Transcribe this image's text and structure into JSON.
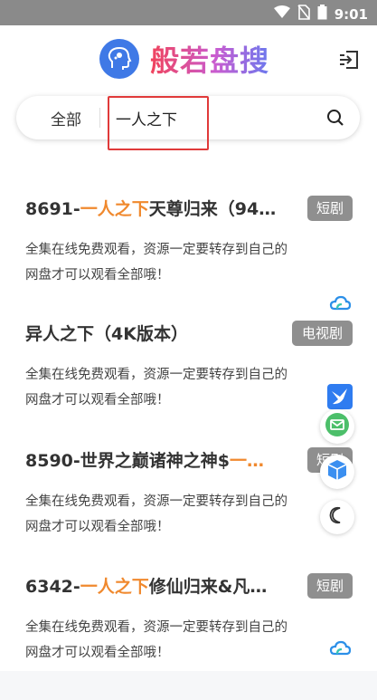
{
  "status_bar": {
    "time": "9:01"
  },
  "header": {
    "app_title": "般若盘搜"
  },
  "search": {
    "scope_label": "全部",
    "query": "一人之下"
  },
  "results": [
    {
      "title_prefix": "8691-",
      "title_highlight": "一人之下",
      "title_suffix": "天尊归来（94…",
      "badge": "短剧",
      "desc": "全集在线免费观看，资源一定要转存到自己的网盘才可以观看全部哦！",
      "source_icon": "cloud-icon"
    },
    {
      "title_prefix": "异人之下（4K版本）",
      "title_highlight": "",
      "title_suffix": "",
      "badge": "电视剧",
      "desc": "全集在线免费观看，资源一定要转存到自己的网盘才可以观看全部哦！",
      "source_icon": "swallow-icon"
    },
    {
      "title_prefix": "8590-世界之巅诸神之神$",
      "title_highlight": "一…",
      "title_suffix": "",
      "badge": "短剧",
      "desc": "全集在线免费观看，资源一定要转存到自己的网盘才可以观看全部哦！",
      "source_icon": ""
    },
    {
      "title_prefix": "6342-",
      "title_highlight": "一人之下",
      "title_suffix": "修仙归来&凡…",
      "badge": "短剧",
      "desc": "全集在线免费观看，资源一定要转存到自己的网盘才可以观看全部哦！",
      "source_icon": "cloud-icon"
    }
  ],
  "colors": {
    "accent_orange": "#f0892e",
    "badge_gray": "#8f8f8f",
    "logo_blue": "#3f79e6"
  }
}
